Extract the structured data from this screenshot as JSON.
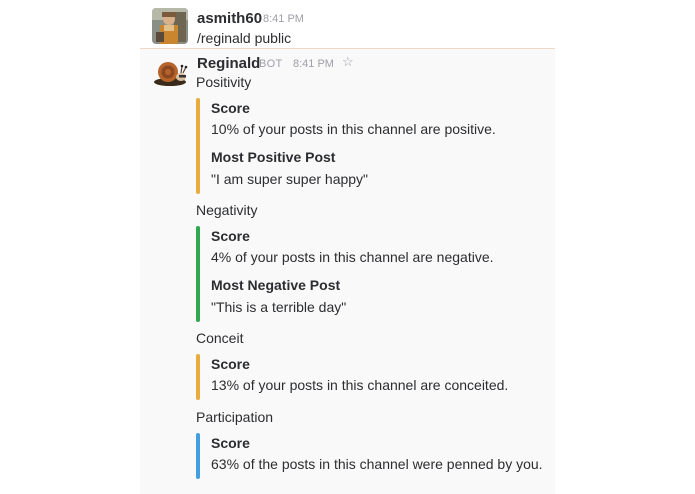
{
  "messages": [
    {
      "sender": "asmith60",
      "time": "8:41 PM",
      "text": "/reginald public"
    },
    {
      "sender": "Reginald",
      "tag": "BOT",
      "time": "8:41 PM",
      "star_icon": "star-icon",
      "sections": [
        {
          "title": "Positivity",
          "color": "#e8ad3e",
          "fields": [
            {
              "title": "Score",
              "value": "10% of your posts in this channel are positive."
            },
            {
              "title": "Most Positive Post",
              "value": "\"I am super super happy\""
            }
          ]
        },
        {
          "title": "Negativity",
          "color": "#2fa84f",
          "fields": [
            {
              "title": "Score",
              "value": "4% of your posts in this channel are negative."
            },
            {
              "title": "Most Negative Post",
              "value": "\"This is a terrible day\""
            }
          ]
        },
        {
          "title": "Conceit",
          "color": "#e8ad3e",
          "fields": [
            {
              "title": "Score",
              "value": "13% of your posts in this channel are conceited."
            }
          ]
        },
        {
          "title": "Participation",
          "color": "#439fe0",
          "fields": [
            {
              "title": "Score",
              "value": "63% of the posts in this channel were penned by you."
            }
          ]
        }
      ]
    }
  ]
}
